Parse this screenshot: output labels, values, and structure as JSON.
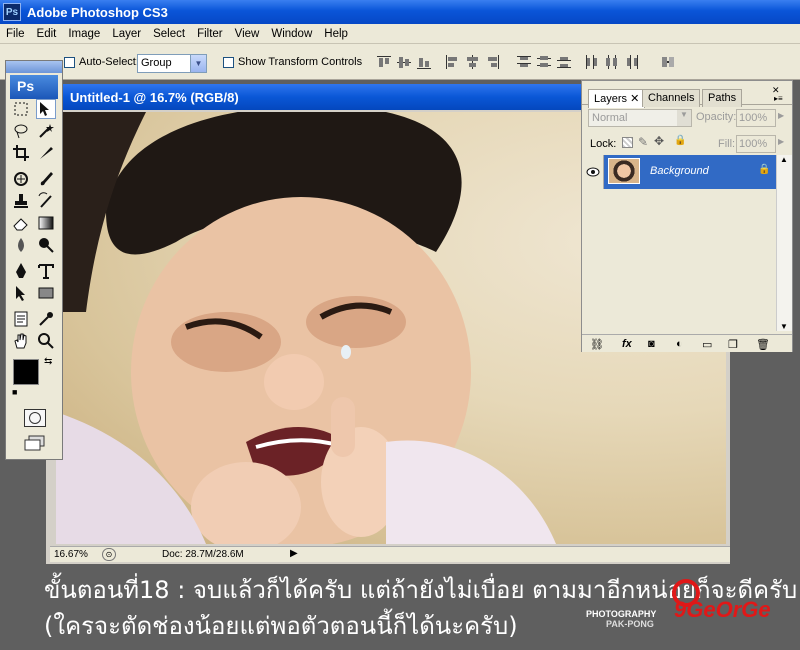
{
  "app": {
    "title": "Adobe Photoshop CS3",
    "icon_text": "Ps"
  },
  "menu": [
    "File",
    "Edit",
    "Image",
    "Layer",
    "Select",
    "Filter",
    "View",
    "Window",
    "Help"
  ],
  "options": {
    "auto_select_label": "Auto-Select:",
    "auto_select_value": "Group",
    "transform_label": "Show Transform Controls"
  },
  "toolbox": {
    "logo": "Ps"
  },
  "document": {
    "title": "Untitled-1 @ 16.7% (RGB/8)",
    "zoom": "16.67%",
    "doc_size": "Doc: 28.7M/28.6M"
  },
  "layers_panel": {
    "tabs": [
      "Layers",
      "Channels",
      "Paths"
    ],
    "blend_mode": "Normal",
    "opacity_label": "Opacity:",
    "opacity_value": "100%",
    "lock_label": "Lock:",
    "fill_label": "Fill:",
    "fill_value": "100%",
    "layer_name": "Background"
  },
  "caption": {
    "line1": "ขั้นตอนที่18 : จบแล้วก็ได้ครับ แต่ถ้ายังไม่เบื่อย ตามมาอีกหน่อยก็จะดีครับ",
    "line2": "(ใครจะตัดช่องน้อยแต่พอตัวตอนนี้ก็ได้นะครับ)"
  },
  "watermark": {
    "photography": "PHOTOGRAPHY",
    "by": "PAK-PONG",
    "brand": "9GeOrGe"
  },
  "colors": {
    "title_blue": "#0a55d8",
    "selection_blue": "#316ac5",
    "panel_bg": "#ece9d8"
  }
}
